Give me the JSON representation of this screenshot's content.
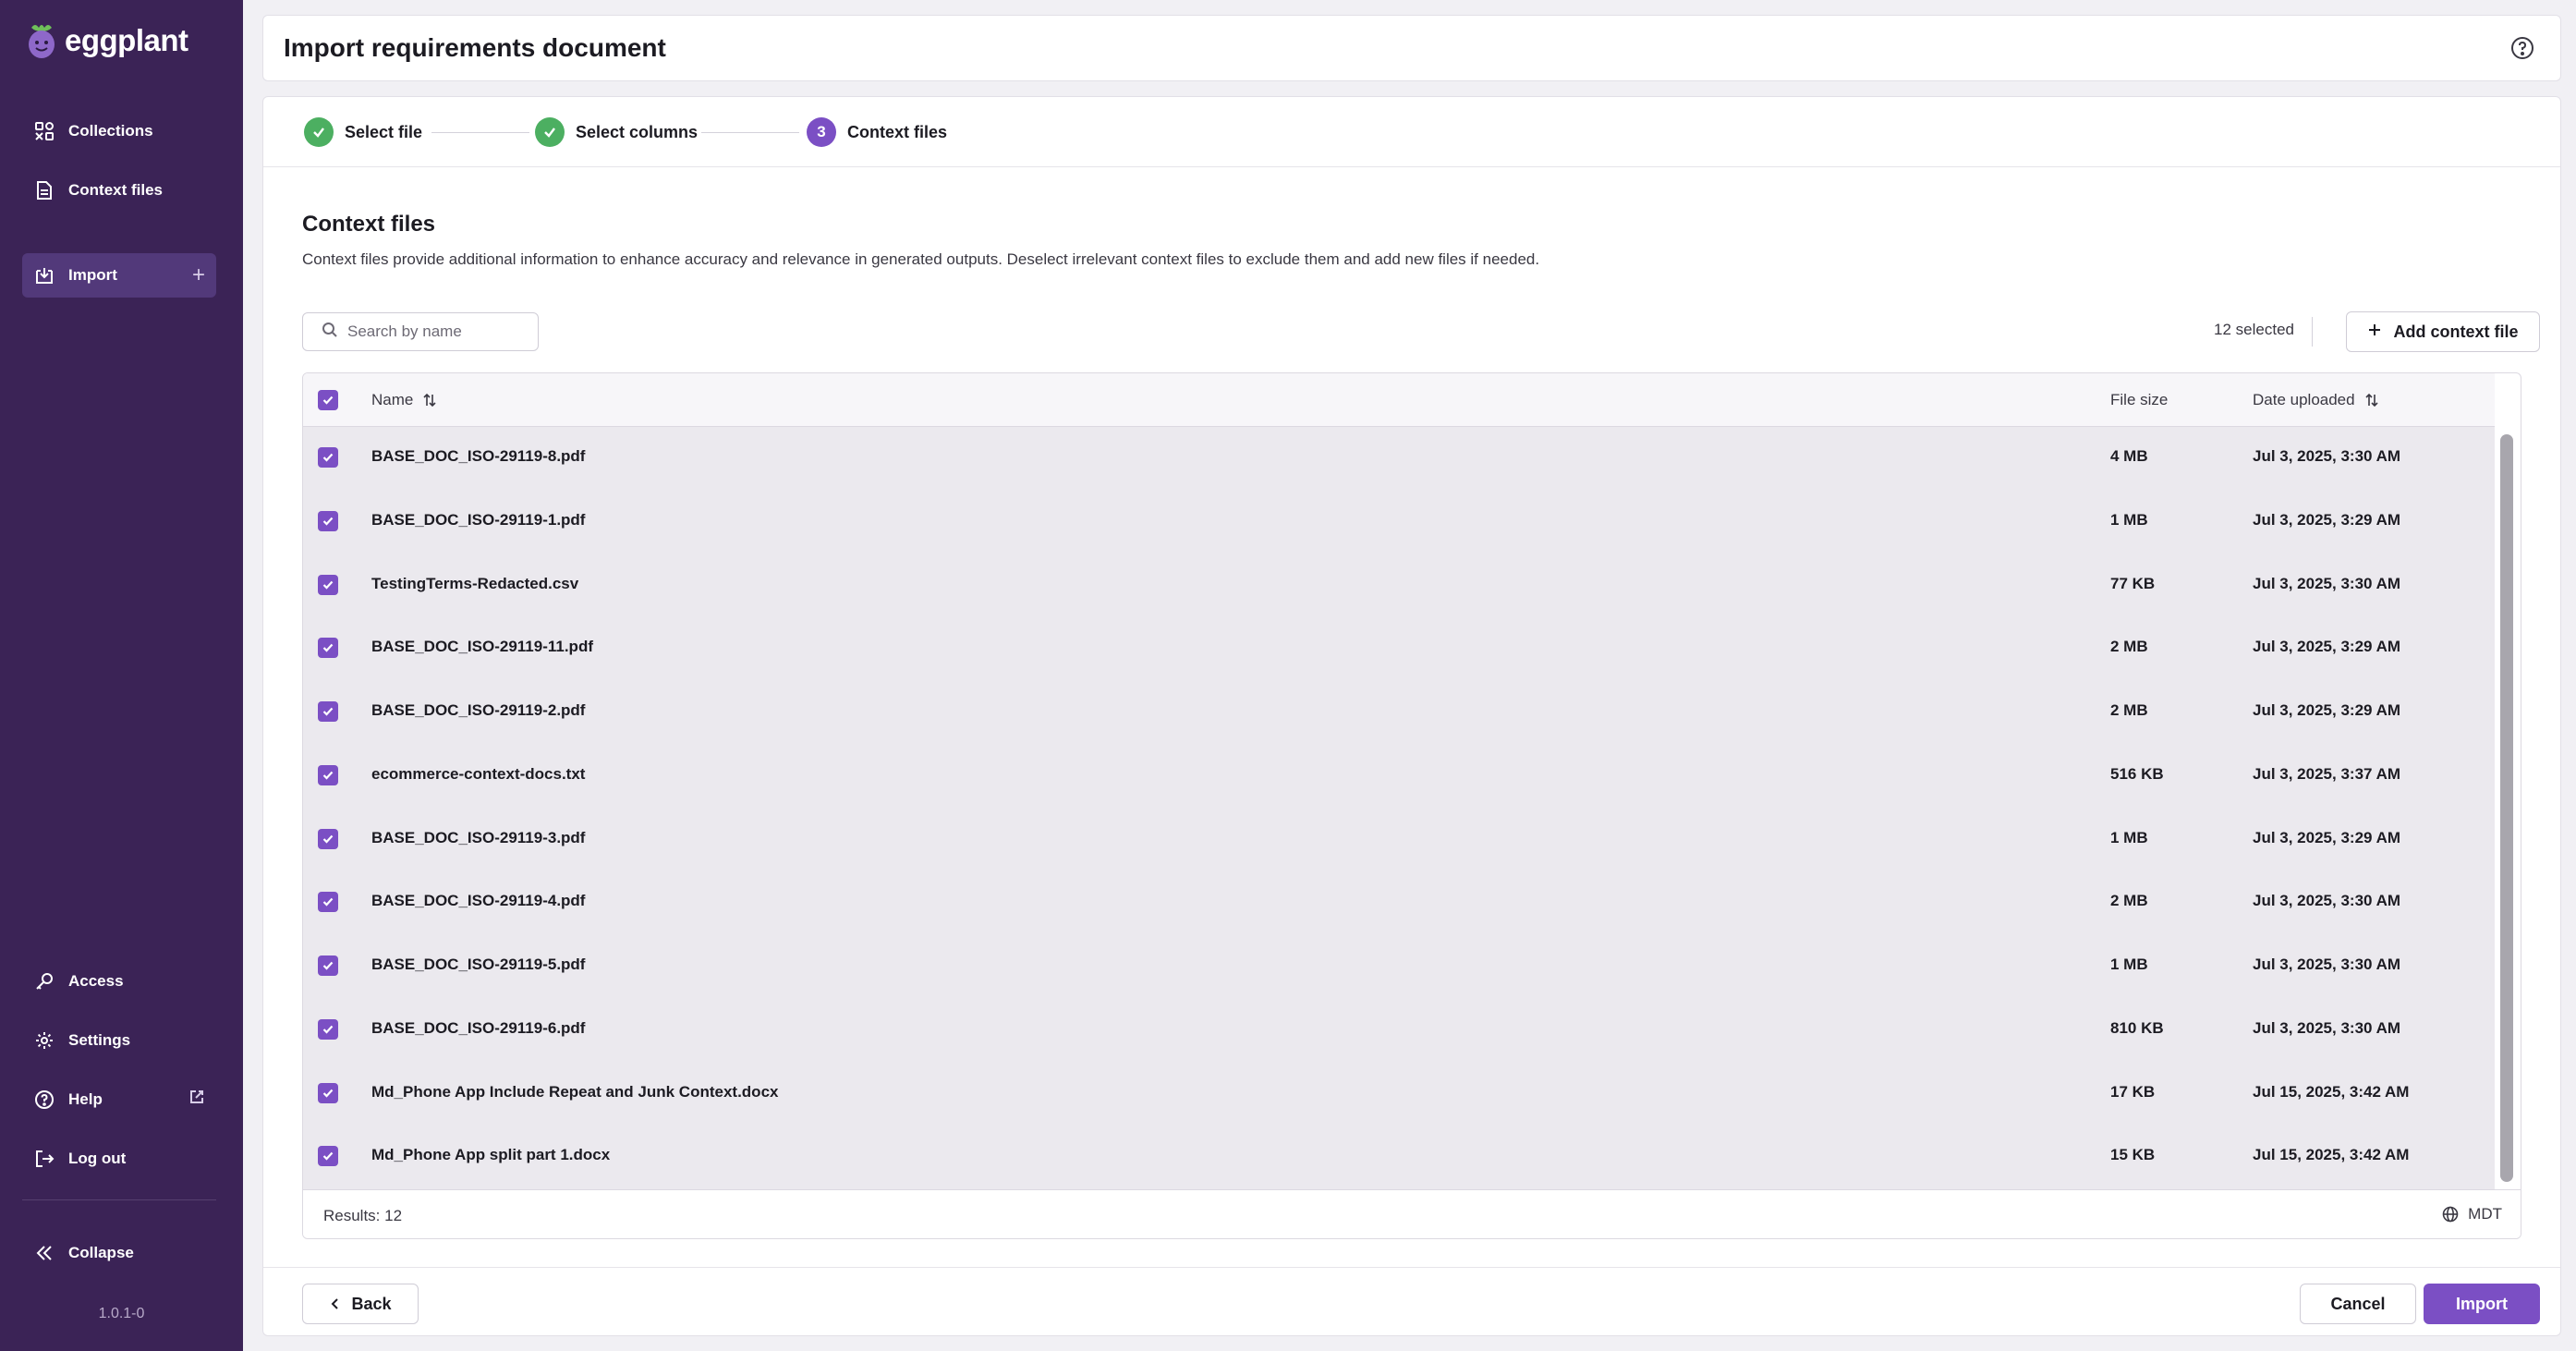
{
  "app": {
    "logo_text": "eggplant",
    "version": "1.0.1-0"
  },
  "sidebar": {
    "top_items": [
      {
        "label": "Collections",
        "icon": "collections-icon"
      },
      {
        "label": "Context files",
        "icon": "document-icon"
      },
      {
        "label": "Import",
        "icon": "import-icon",
        "active": true
      }
    ],
    "bottom_items": [
      {
        "label": "Access",
        "icon": "key-icon"
      },
      {
        "label": "Settings",
        "icon": "gear-icon"
      },
      {
        "label": "Help",
        "icon": "help-icon"
      },
      {
        "label": "Log out",
        "icon": "logout-icon"
      }
    ],
    "collapse_label": "Collapse"
  },
  "header": {
    "title": "Import requirements document"
  },
  "stepper": {
    "steps": [
      {
        "label": "Select file",
        "state": "done"
      },
      {
        "label": "Select columns",
        "state": "done"
      },
      {
        "label": "Context files",
        "state": "current",
        "number": "3"
      }
    ]
  },
  "section": {
    "title": "Context files",
    "description": "Context files provide additional information to enhance accuracy and relevance in generated outputs. Deselect irrelevant context files to exclude them and add new files if needed."
  },
  "toolbar": {
    "search_placeholder": "Search by name",
    "selected_count": "12 selected",
    "add_label": "Add context file"
  },
  "table": {
    "columns": {
      "name": "Name",
      "size": "File size",
      "date": "Date uploaded"
    },
    "rows": [
      {
        "name": "BASE_DOC_ISO-29119-8.pdf",
        "size": "4 MB",
        "date": "Jul 3, 2025, 3:30 AM"
      },
      {
        "name": "BASE_DOC_ISO-29119-1.pdf",
        "size": "1 MB",
        "date": "Jul 3, 2025, 3:29 AM"
      },
      {
        "name": "TestingTerms-Redacted.csv",
        "size": "77 KB",
        "date": "Jul 3, 2025, 3:30 AM"
      },
      {
        "name": "BASE_DOC_ISO-29119-11.pdf",
        "size": "2 MB",
        "date": "Jul 3, 2025, 3:29 AM"
      },
      {
        "name": "BASE_DOC_ISO-29119-2.pdf",
        "size": "2 MB",
        "date": "Jul 3, 2025, 3:29 AM"
      },
      {
        "name": "ecommerce-context-docs.txt",
        "size": "516 KB",
        "date": "Jul 3, 2025, 3:37 AM"
      },
      {
        "name": "BASE_DOC_ISO-29119-3.pdf",
        "size": "1 MB",
        "date": "Jul 3, 2025, 3:29 AM"
      },
      {
        "name": "BASE_DOC_ISO-29119-4.pdf",
        "size": "2 MB",
        "date": "Jul 3, 2025, 3:30 AM"
      },
      {
        "name": "BASE_DOC_ISO-29119-5.pdf",
        "size": "1 MB",
        "date": "Jul 3, 2025, 3:30 AM"
      },
      {
        "name": "BASE_DOC_ISO-29119-6.pdf",
        "size": "810 KB",
        "date": "Jul 3, 2025, 3:30 AM"
      },
      {
        "name": "Md_Phone App Include Repeat and Junk Context.docx",
        "size": "17 KB",
        "date": "Jul 15, 2025, 3:42 AM"
      },
      {
        "name": "Md_Phone App split part 1.docx",
        "size": "15 KB",
        "date": "Jul 15, 2025, 3:42 AM"
      }
    ],
    "results": "Results: 12",
    "timezone": "MDT"
  },
  "footer": {
    "back_label": "Back",
    "cancel_label": "Cancel",
    "import_label": "Import"
  },
  "colors": {
    "sidebar_bg": "#3b2356",
    "accent": "#7b4fc4",
    "success": "#4caf61"
  }
}
